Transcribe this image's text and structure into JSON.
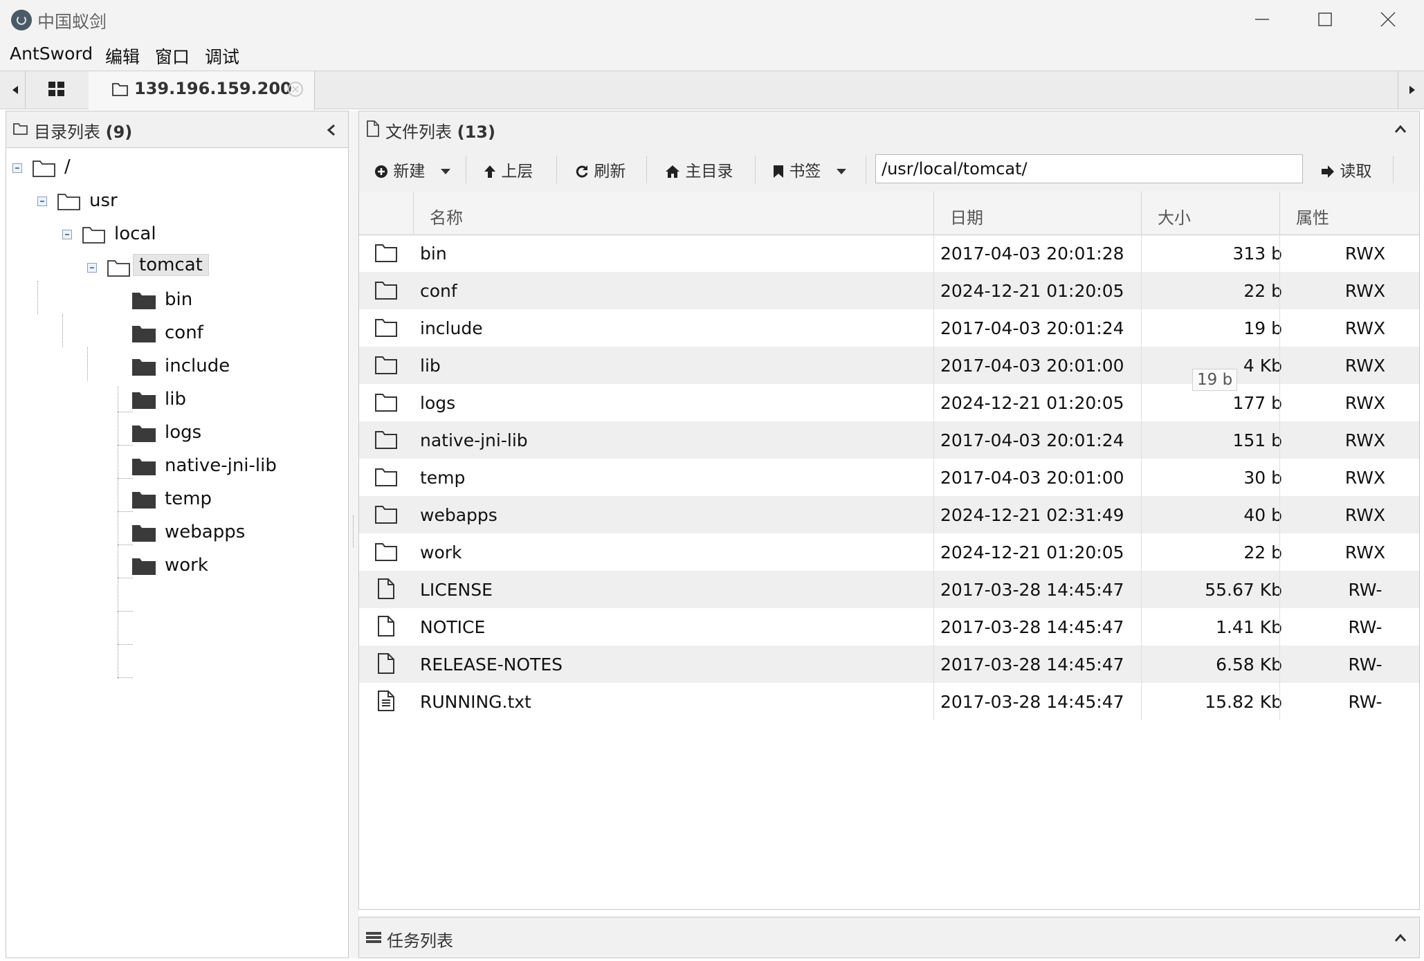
{
  "window": {
    "title": "中国蚁剑"
  },
  "menu": [
    "AntSword",
    "编辑",
    "窗口",
    "调试"
  ],
  "tabs": {
    "active": "139.196.159.200"
  },
  "left_panel": {
    "title": "目录列表",
    "count": "(9)",
    "tree": {
      "root": "/",
      "usr": "usr",
      "local": "local",
      "tomcat": "tomcat",
      "children": [
        "bin",
        "conf",
        "include",
        "lib",
        "logs",
        "native-jni-lib",
        "temp",
        "webapps",
        "work"
      ]
    }
  },
  "right_panel": {
    "title": "文件列表",
    "count": "(13)",
    "toolbar": {
      "new": "新建",
      "up": "上层",
      "refresh": "刷新",
      "home": "主目录",
      "bookmark": "书签",
      "read": "读取"
    },
    "path": "/usr/local/tomcat/",
    "columns": [
      "名称",
      "日期",
      "大小",
      "属性"
    ],
    "files": [
      {
        "name": "bin",
        "date": "2017-04-03 20:01:28",
        "size": "313 b",
        "attr": "RWX",
        "type": "folder"
      },
      {
        "name": "conf",
        "date": "2024-12-21 01:20:05",
        "size": "22 b",
        "attr": "RWX",
        "type": "folder"
      },
      {
        "name": "include",
        "date": "2017-04-03 20:01:24",
        "size": "19 b",
        "attr": "RWX",
        "type": "folder"
      },
      {
        "name": "lib",
        "date": "2017-04-03 20:01:00",
        "size": "4 Kb",
        "attr": "RWX",
        "type": "folder"
      },
      {
        "name": "logs",
        "date": "2024-12-21 01:20:05",
        "size": "177 b",
        "attr": "RWX",
        "type": "folder"
      },
      {
        "name": "native-jni-lib",
        "date": "2017-04-03 20:01:24",
        "size": "151 b",
        "attr": "RWX",
        "type": "folder"
      },
      {
        "name": "temp",
        "date": "2017-04-03 20:01:00",
        "size": "30 b",
        "attr": "RWX",
        "type": "folder"
      },
      {
        "name": "webapps",
        "date": "2024-12-21 02:31:49",
        "size": "40 b",
        "attr": "RWX",
        "type": "folder"
      },
      {
        "name": "work",
        "date": "2024-12-21 01:20:05",
        "size": "22 b",
        "attr": "RWX",
        "type": "folder"
      },
      {
        "name": "LICENSE",
        "date": "2017-03-28 14:45:47",
        "size": "55.67 Kb",
        "attr": "RW-",
        "type": "file"
      },
      {
        "name": "NOTICE",
        "date": "2017-03-28 14:45:47",
        "size": "1.41 Kb",
        "attr": "RW-",
        "type": "file"
      },
      {
        "name": "RELEASE-NOTES",
        "date": "2017-03-28 14:45:47",
        "size": "6.58 Kb",
        "attr": "RW-",
        "type": "file"
      },
      {
        "name": "RUNNING.txt",
        "date": "2017-03-28 14:45:47",
        "size": "15.82 Kb",
        "attr": "RW-",
        "type": "text"
      }
    ],
    "tooltip": "19 b"
  },
  "task_panel": {
    "title": "任务列表"
  }
}
